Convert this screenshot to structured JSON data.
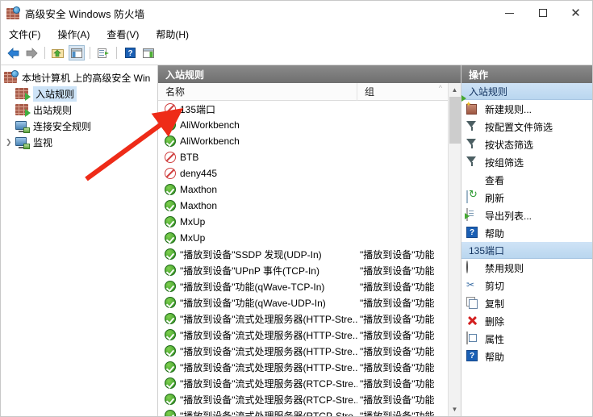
{
  "window": {
    "title": "高级安全 Windows 防火墙",
    "icon": "firewall-shield-icon",
    "controls": {
      "minimize": "—",
      "maximize": "□",
      "close": "✕"
    }
  },
  "menubar": [
    {
      "label": "文件(F)"
    },
    {
      "label": "操作(A)"
    },
    {
      "label": "查看(V)"
    },
    {
      "label": "帮助(H)"
    }
  ],
  "toolbar": [
    {
      "name": "back-arrow-icon"
    },
    {
      "name": "forward-arrow-icon"
    },
    {
      "name": "up-folder-icon"
    },
    {
      "name": "show-console-tree-icon"
    },
    {
      "name": "export-list-icon"
    },
    {
      "name": "help-icon"
    },
    {
      "name": "show-action-pane-icon"
    }
  ],
  "tree": {
    "root": {
      "label": "本地计算机 上的高级安全 Win",
      "icon": "firewall-computer-icon"
    },
    "items": [
      {
        "label": "入站规则",
        "icon": "inbound-rules-icon",
        "selected": true,
        "expandable": false
      },
      {
        "label": "出站规则",
        "icon": "outbound-rules-icon",
        "selected": false,
        "expandable": false
      },
      {
        "label": "连接安全规则",
        "icon": "connection-security-icon",
        "selected": false,
        "expandable": false
      },
      {
        "label": "监视",
        "icon": "monitoring-icon",
        "selected": false,
        "expandable": true
      }
    ]
  },
  "list": {
    "header": "入站规则",
    "columns": [
      {
        "label": "名称"
      },
      {
        "label": "组"
      }
    ],
    "rows": [
      {
        "name": "135端口",
        "group": "",
        "status": "block"
      },
      {
        "name": "AliWorkbench",
        "group": "",
        "status": "allow"
      },
      {
        "name": "AliWorkbench",
        "group": "",
        "status": "allow"
      },
      {
        "name": "BTB",
        "group": "",
        "status": "block"
      },
      {
        "name": "deny445",
        "group": "",
        "status": "block"
      },
      {
        "name": "Maxthon",
        "group": "",
        "status": "allow"
      },
      {
        "name": "Maxthon",
        "group": "",
        "status": "allow"
      },
      {
        "name": "MxUp",
        "group": "",
        "status": "allow"
      },
      {
        "name": "MxUp",
        "group": "",
        "status": "allow"
      },
      {
        "name": "\"播放到设备\"SSDP 发现(UDP-In)",
        "group": "\"播放到设备\"功能",
        "status": "allow"
      },
      {
        "name": "\"播放到设备\"UPnP 事件(TCP-In)",
        "group": "\"播放到设备\"功能",
        "status": "allow"
      },
      {
        "name": "\"播放到设备\"功能(qWave-TCP-In)",
        "group": "\"播放到设备\"功能",
        "status": "allow"
      },
      {
        "name": "\"播放到设备\"功能(qWave-UDP-In)",
        "group": "\"播放到设备\"功能",
        "status": "allow"
      },
      {
        "name": "\"播放到设备\"流式处理服务器(HTTP-Stre...",
        "group": "\"播放到设备\"功能",
        "status": "allow"
      },
      {
        "name": "\"播放到设备\"流式处理服务器(HTTP-Stre...",
        "group": "\"播放到设备\"功能",
        "status": "allow"
      },
      {
        "name": "\"播放到设备\"流式处理服务器(HTTP-Stre...",
        "group": "\"播放到设备\"功能",
        "status": "allow"
      },
      {
        "name": "\"播放到设备\"流式处理服务器(HTTP-Stre...",
        "group": "\"播放到设备\"功能",
        "status": "allow"
      },
      {
        "name": "\"播放到设备\"流式处理服务器(RTCP-Stre...",
        "group": "\"播放到设备\"功能",
        "status": "allow"
      },
      {
        "name": "\"播放到设备\"流式处理服务器(RTCP-Stre...",
        "group": "\"播放到设备\"功能",
        "status": "allow"
      },
      {
        "name": "\"播放到设备\"流式处理服务器(RTCP-Stre...",
        "group": "\"播放到设备\"功能",
        "status": "allow"
      }
    ]
  },
  "actions": {
    "header": "操作",
    "sections": [
      {
        "title": "入站规则",
        "items": [
          {
            "label": "新建规则...",
            "icon": "new-rule-icon"
          },
          {
            "label": "按配置文件筛选",
            "icon": "filter-funnel-icon"
          },
          {
            "label": "按状态筛选",
            "icon": "filter-funnel-icon"
          },
          {
            "label": "按组筛选",
            "icon": "filter-funnel-icon"
          },
          {
            "label": "查看",
            "icon": "none"
          },
          {
            "label": "刷新",
            "icon": "refresh-icon"
          },
          {
            "label": "导出列表...",
            "icon": "export-list-icon"
          },
          {
            "label": "帮助",
            "icon": "help-icon"
          }
        ]
      },
      {
        "title": "135端口",
        "items": [
          {
            "label": "禁用规则",
            "icon": "disable-rule-icon"
          },
          {
            "label": "剪切",
            "icon": "cut-icon"
          },
          {
            "label": "复制",
            "icon": "copy-icon"
          },
          {
            "label": "删除",
            "icon": "delete-icon"
          },
          {
            "label": "属性",
            "icon": "properties-icon"
          },
          {
            "label": "帮助",
            "icon": "help-icon"
          }
        ]
      }
    ]
  },
  "annotation": {
    "type": "arrow",
    "color": "#ee2b18",
    "points_to": "135端口 row status icon"
  }
}
